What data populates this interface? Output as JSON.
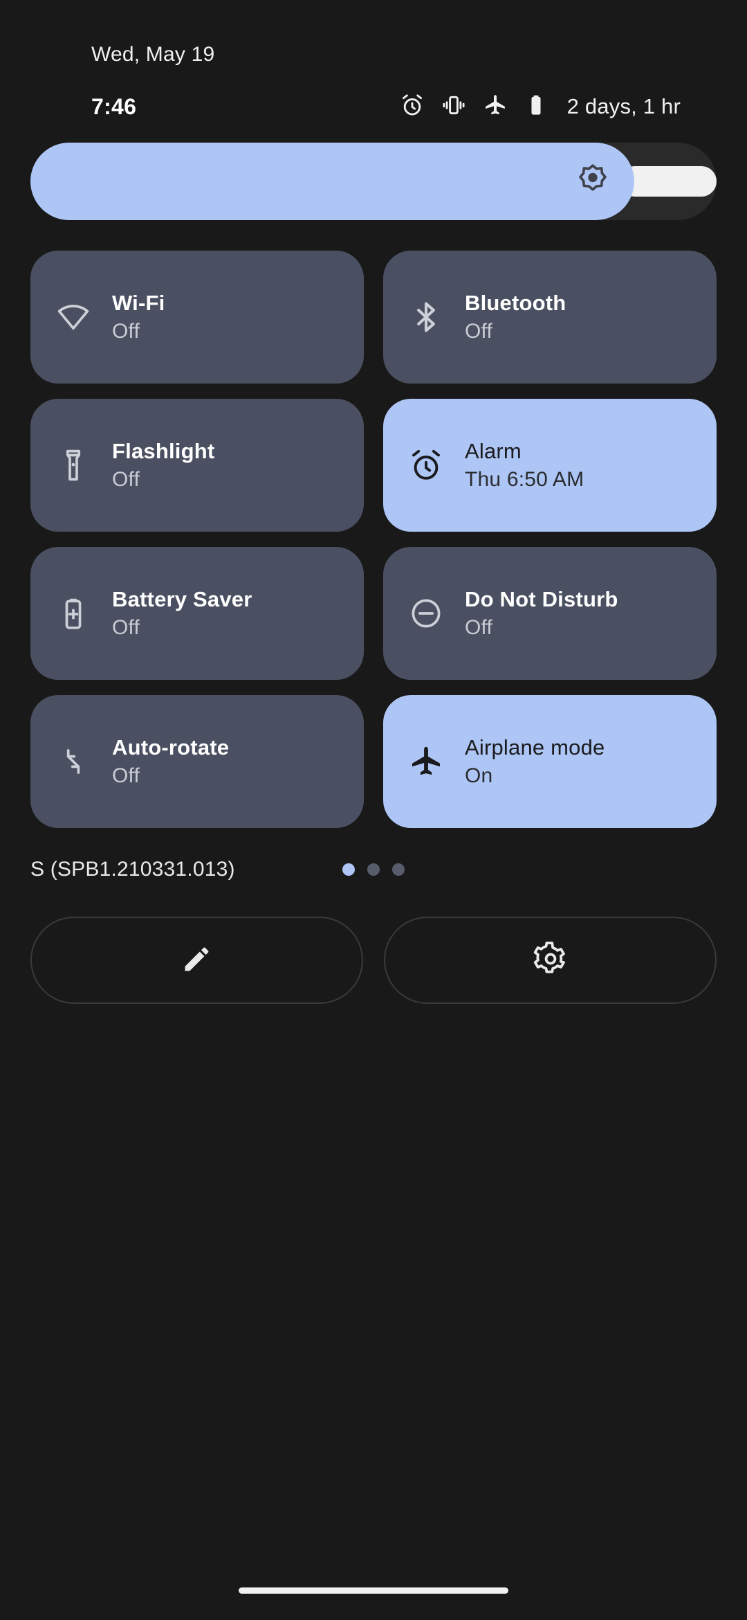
{
  "statusbar": {
    "date": "Wed, May 19",
    "time": "7:46",
    "battery_estimate": "2 days, 1 hr",
    "icons": [
      "alarm-icon",
      "vibrate-icon",
      "airplane-icon",
      "battery-icon"
    ]
  },
  "brightness": {
    "name": "brightness-slider",
    "icon": "brightness-sun-icon",
    "level_percent": 88,
    "fill_color": "#aec6f6",
    "track_color": "#2a2a2a"
  },
  "tiles": [
    {
      "label": "Wi-Fi",
      "state": "Off",
      "icon": "wifi-icon",
      "active": false
    },
    {
      "label": "Bluetooth",
      "state": "Off",
      "icon": "bluetooth-icon",
      "active": false
    },
    {
      "label": "Flashlight",
      "state": "Off",
      "icon": "flashlight-icon",
      "active": false
    },
    {
      "label": "Alarm",
      "state": "Thu 6:50 AM",
      "icon": "alarm-clock-icon",
      "active": true
    },
    {
      "label": "Battery Saver",
      "state": "Off",
      "icon": "battery-saver-icon",
      "active": false
    },
    {
      "label": "Do Not Disturb",
      "state": "Off",
      "icon": "do-not-disturb-icon",
      "active": false
    },
    {
      "label": "Auto-rotate",
      "state": "Off",
      "icon": "auto-rotate-icon",
      "active": false
    },
    {
      "label": "Airplane mode",
      "state": "On",
      "icon": "airplane-icon",
      "active": true
    }
  ],
  "footer": {
    "build": "S (SPB1.210331.013)",
    "page_count": 3,
    "page_active_index": 0
  },
  "bottom_buttons": [
    {
      "name": "edit-tiles-button",
      "icon": "pencil-icon"
    },
    {
      "name": "open-settings-button",
      "icon": "gear-icon"
    }
  ],
  "colors": {
    "background": "#191919",
    "tile_inactive": "#4a5061",
    "tile_active": "#aec6f6",
    "text_primary": "#ffffff",
    "text_secondary": "#c9ccd4"
  }
}
